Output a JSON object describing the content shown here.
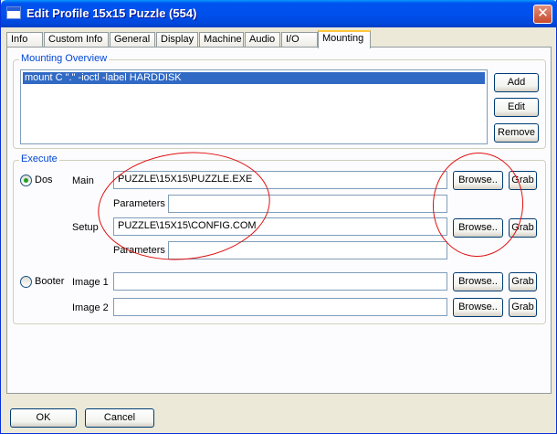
{
  "window": {
    "title": "Edit Profile 15x15 Puzzle (554)",
    "close_symbol": "✕"
  },
  "tabs": [
    {
      "label": "Info"
    },
    {
      "label": "Custom Info"
    },
    {
      "label": "General"
    },
    {
      "label": "Display"
    },
    {
      "label": "Machine"
    },
    {
      "label": "Audio"
    },
    {
      "label": "I/O"
    },
    {
      "label": "Mounting"
    }
  ],
  "mounting": {
    "group_label": "Mounting Overview",
    "items": [
      "mount C \".\" -ioctl -label HARDDISK"
    ],
    "add_label": "Add",
    "edit_label": "Edit",
    "remove_label": "Remove"
  },
  "execute": {
    "group_label": "Execute",
    "dos_label": "Dos",
    "main_label": "Main",
    "main_value": "PUZZLE\\15X15\\PUZZLE.EXE",
    "parameters_label": "Parameters",
    "main_params_value": "",
    "setup_label": "Setup",
    "setup_value": "PUZZLE\\15X15\\CONFIG.COM",
    "setup_params_value": "",
    "booter_label": "Booter",
    "image1_label": "Image 1",
    "image1_value": "",
    "image2_label": "Image 2",
    "image2_value": "",
    "browse_label": "Browse..",
    "grab_label": "Grab"
  },
  "footer": {
    "ok_label": "OK",
    "cancel_label": "Cancel"
  }
}
